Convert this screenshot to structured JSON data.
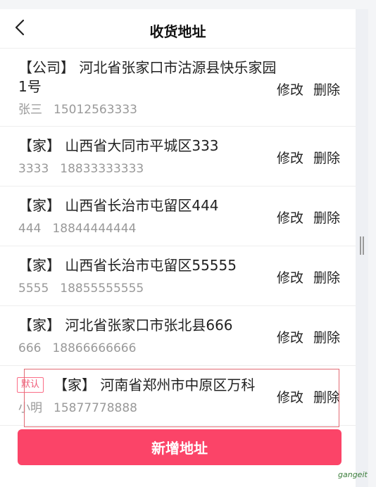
{
  "header": {
    "title": "收货地址",
    "back_icon": "chevron-left-icon"
  },
  "addresses": [
    {
      "tag": "【公司】",
      "address": "河北省张家口市沽源县快乐家园1号",
      "name": "张三",
      "phone": "15012563333",
      "edit_label": "修改",
      "delete_label": "删除",
      "is_default": false
    },
    {
      "tag": "【家】",
      "address": "山西省大同市平城区333",
      "name": "3333",
      "phone": "18833333333",
      "edit_label": "修改",
      "delete_label": "删除",
      "is_default": false
    },
    {
      "tag": "【家】",
      "address": "山西省长治市屯留区444",
      "name": "444",
      "phone": "18844444444",
      "edit_label": "修改",
      "delete_label": "删除",
      "is_default": false
    },
    {
      "tag": "【家】",
      "address": "山西省长治市屯留区55555",
      "name": "5555",
      "phone": "18855555555",
      "edit_label": "修改",
      "delete_label": "删除",
      "is_default": false
    },
    {
      "tag": "【家】",
      "address": "河北省张家口市张北县666",
      "name": "666",
      "phone": "18866666666",
      "edit_label": "修改",
      "delete_label": "删除",
      "is_default": false
    },
    {
      "tag": "【家】",
      "address": "河南省郑州市中原区万科",
      "name": "小明",
      "phone": "15877778888",
      "edit_label": "修改",
      "delete_label": "删除",
      "is_default": true,
      "default_badge": "默认"
    }
  ],
  "footer": {
    "add_button_label": "新增地址"
  },
  "watermark": "gangeit",
  "colors": {
    "accent": "#fb4468",
    "badge": "#f05a77",
    "highlight_border": "#e26a73"
  }
}
